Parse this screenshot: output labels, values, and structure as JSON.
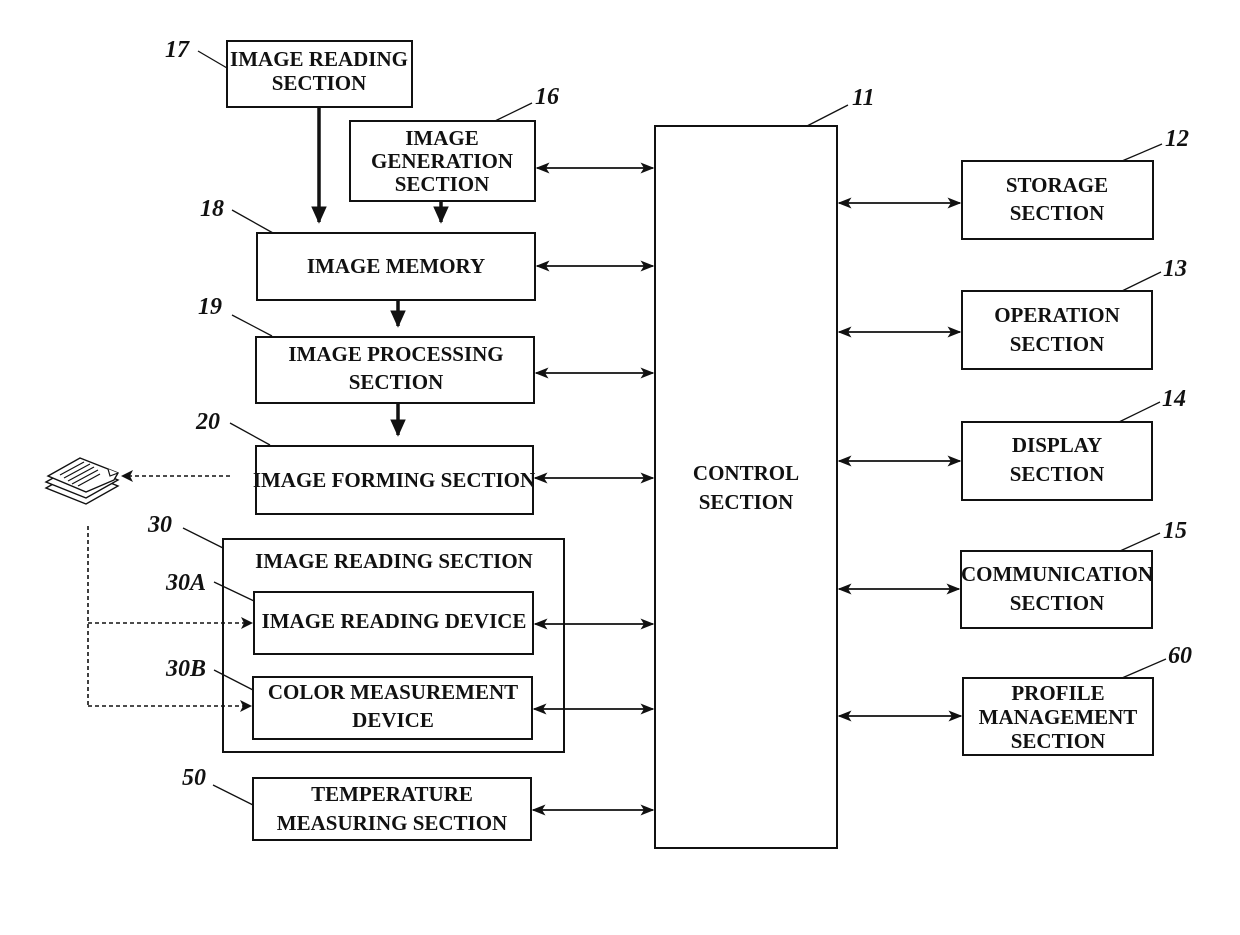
{
  "diagram": {
    "blocks": {
      "image_reading_17": {
        "ref": "17",
        "lines": [
          "IMAGE READING",
          "SECTION"
        ]
      },
      "image_generation_16": {
        "ref": "16",
        "lines": [
          "IMAGE",
          "GENERATION",
          "SECTION"
        ]
      },
      "image_memory_18": {
        "ref": "18",
        "lines": [
          "IMAGE MEMORY"
        ]
      },
      "image_processing_19": {
        "ref": "19",
        "lines": [
          "IMAGE PROCESSING",
          "SECTION"
        ]
      },
      "image_forming_20": {
        "ref": "20",
        "lines": [
          "IMAGE FORMING SECTION"
        ]
      },
      "image_reading_30": {
        "ref": "30",
        "lines": [
          "IMAGE READING SECTION"
        ]
      },
      "image_reading_device_30A": {
        "ref": "30A",
        "lines": [
          "IMAGE READING DEVICE"
        ]
      },
      "color_measurement_30B": {
        "ref": "30B",
        "lines": [
          "COLOR MEASUREMENT",
          "DEVICE"
        ]
      },
      "temperature_50": {
        "ref": "50",
        "lines": [
          "TEMPERATURE",
          "MEASURING SECTION"
        ]
      },
      "control_11": {
        "ref": "11",
        "lines": [
          "CONTROL",
          "SECTION"
        ]
      },
      "storage_12": {
        "ref": "12",
        "lines": [
          "STORAGE",
          "SECTION"
        ]
      },
      "operation_13": {
        "ref": "13",
        "lines": [
          "OPERATION",
          "SECTION"
        ]
      },
      "display_14": {
        "ref": "14",
        "lines": [
          "DISPLAY",
          "SECTION"
        ]
      },
      "communication_15": {
        "ref": "15",
        "lines": [
          "COMMUNICATION",
          "SECTION"
        ]
      },
      "profile_60": {
        "ref": "60",
        "lines": [
          "PROFILE",
          "MANAGEMENT",
          "SECTION"
        ]
      }
    },
    "icons": {
      "paper_stack": "paper-stack-icon"
    },
    "connections": [
      {
        "from": "17",
        "to": "18",
        "style": "thick-arrow"
      },
      {
        "from": "16",
        "to": "18",
        "style": "thick-arrow"
      },
      {
        "from": "18",
        "to": "19",
        "style": "thick-arrow"
      },
      {
        "from": "19",
        "to": "20",
        "style": "thick-arrow"
      },
      {
        "from": "20",
        "to": "paper",
        "style": "dashed-arrow"
      },
      {
        "from": "paper",
        "to": "30A",
        "style": "dashed-arrow"
      },
      {
        "from": "paper",
        "to": "30B",
        "style": "dashed-arrow"
      },
      {
        "from": "11",
        "to": "16",
        "style": "bidirectional"
      },
      {
        "from": "11",
        "to": "18",
        "style": "bidirectional"
      },
      {
        "from": "11",
        "to": "19",
        "style": "bidirectional"
      },
      {
        "from": "11",
        "to": "20",
        "style": "bidirectional"
      },
      {
        "from": "11",
        "to": "30A",
        "style": "bidirectional"
      },
      {
        "from": "11",
        "to": "30B",
        "style": "bidirectional"
      },
      {
        "from": "11",
        "to": "50",
        "style": "bidirectional"
      },
      {
        "from": "11",
        "to": "12",
        "style": "bidirectional"
      },
      {
        "from": "11",
        "to": "13",
        "style": "bidirectional"
      },
      {
        "from": "11",
        "to": "14",
        "style": "bidirectional"
      },
      {
        "from": "11",
        "to": "15",
        "style": "bidirectional"
      },
      {
        "from": "11",
        "to": "60",
        "style": "bidirectional"
      }
    ]
  }
}
